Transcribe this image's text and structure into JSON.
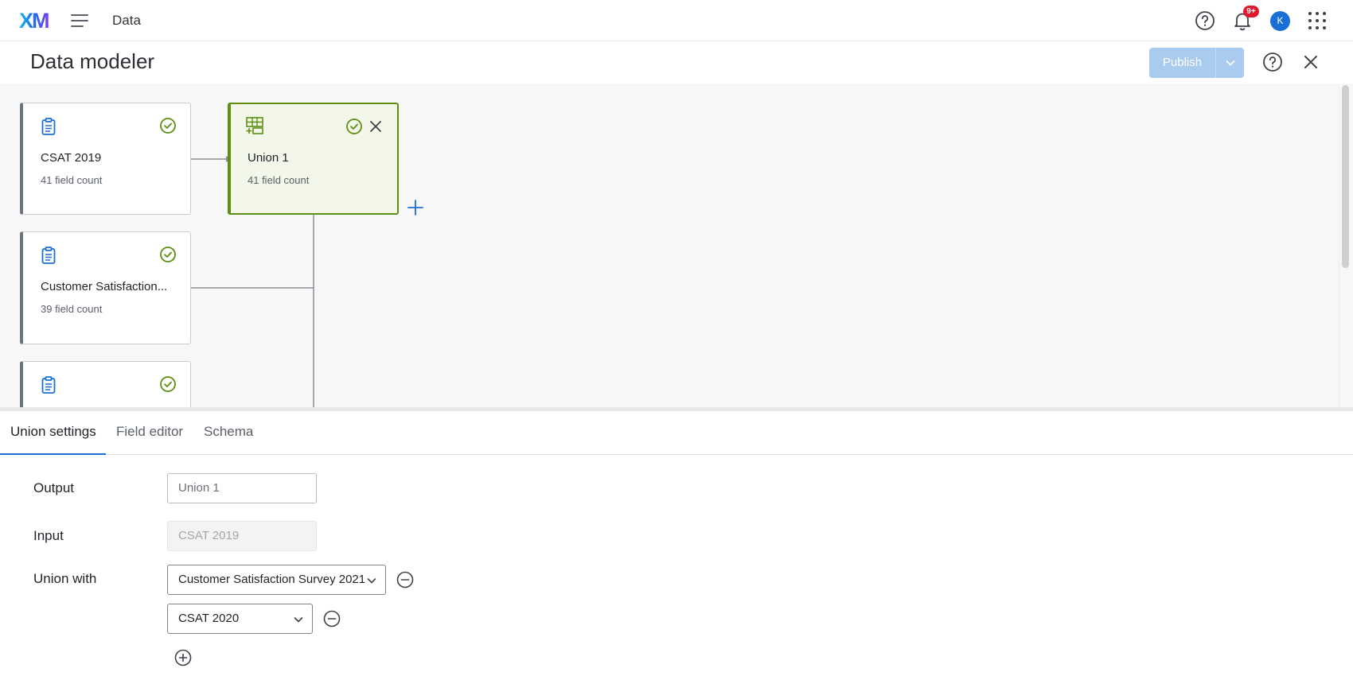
{
  "topbar": {
    "logo_text": "XM",
    "app_title": "Data",
    "notification_badge": "9+",
    "avatar_initial": "K"
  },
  "header": {
    "title": "Data modeler",
    "publish_label": "Publish"
  },
  "canvas": {
    "nodes": [
      {
        "title": "CSAT 2019",
        "subtitle": "41 field count",
        "icon": "survey-clipboard-icon",
        "status": "check-circle-icon"
      },
      {
        "title": "Customer Satisfaction...",
        "subtitle": "39 field count",
        "icon": "survey-clipboard-icon",
        "status": "check-circle-icon"
      },
      {
        "title": "",
        "subtitle": "",
        "icon": "survey-clipboard-icon",
        "status": "check-circle-icon"
      }
    ],
    "union_node": {
      "title": "Union 1",
      "subtitle": "41 field count",
      "icon": "union-table-icon",
      "status": "check-circle-icon"
    }
  },
  "tabs": [
    {
      "label": "Union settings",
      "active": true
    },
    {
      "label": "Field editor",
      "active": false
    },
    {
      "label": "Schema",
      "active": false
    }
  ],
  "form": {
    "output_label": "Output",
    "output_value": "Union 1",
    "input_label": "Input",
    "input_value": "CSAT 2019",
    "union_with_label": "Union with",
    "union_with": [
      "Customer Satisfaction Survey 2021",
      "CSAT 2020"
    ]
  },
  "colors": {
    "accent": "#1a6fd6",
    "success": "#5e8f12",
    "publish_disabled": "#a9cbef",
    "badge": "#e0182d"
  }
}
